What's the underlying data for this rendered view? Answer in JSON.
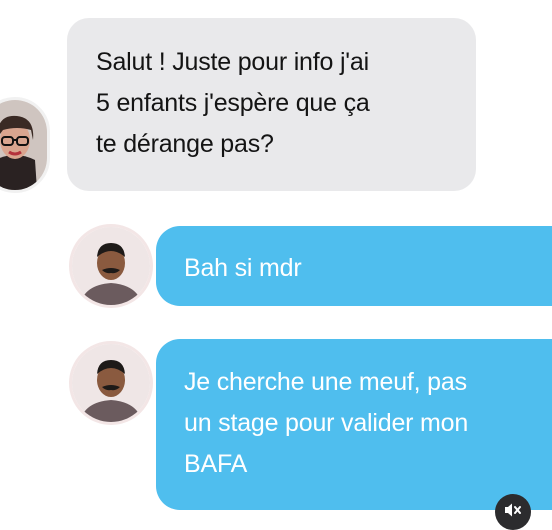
{
  "messages": [
    {
      "sender": "her",
      "text": "Salut ! Juste pour info j'ai\n5 enfants j'espère que ça\nte dérange pas?"
    },
    {
      "sender": "him",
      "text": "Bah si mdr"
    },
    {
      "sender": "him",
      "text": "Je cherche une meuf, pas\nun stage pour valider mon\nBAFA"
    }
  ],
  "colors": {
    "received_bubble": "#e9e9eb",
    "sent_bubble": "#4fbeee",
    "sent_text": "#ffffff",
    "received_text": "#141414"
  },
  "icons": {
    "mute": "speaker-muted-icon"
  }
}
